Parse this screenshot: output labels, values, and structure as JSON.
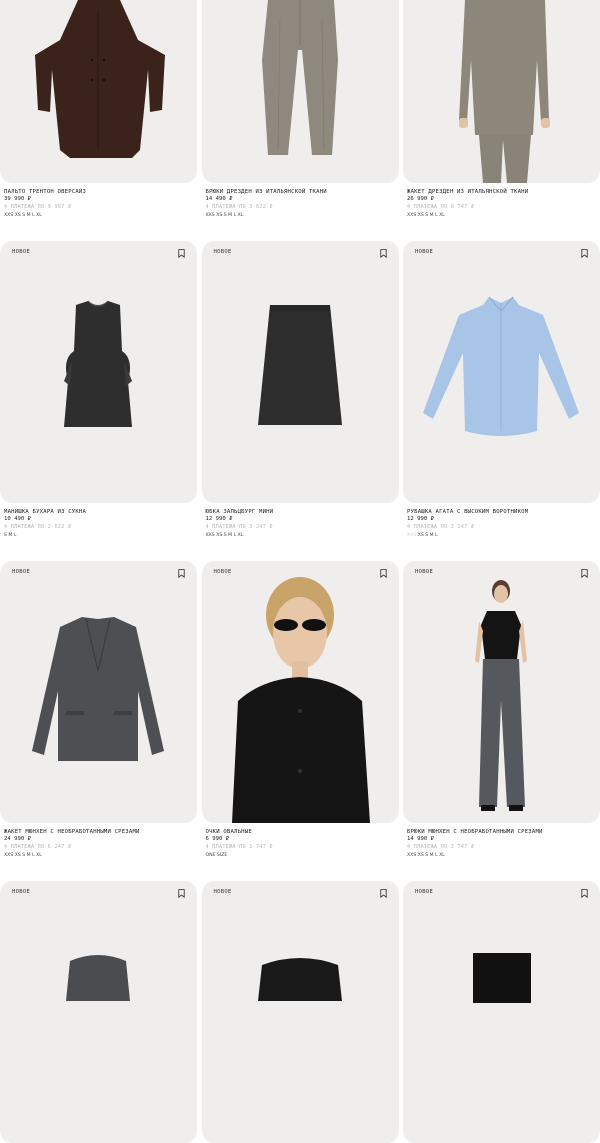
{
  "products": [
    {
      "title": "ПАЛЬТО ТРЕНТОН ОВЕРСАЙЗ",
      "price": "39 990 ₽",
      "installment": "4 ПЛАТЕЖА ПО 9 997 ₽",
      "sizes": [
        {
          "s": "XXS",
          "a": true
        },
        {
          "s": "XS",
          "a": true
        },
        {
          "s": "S",
          "a": true
        },
        {
          "s": "M",
          "a": true
        },
        {
          "s": "L",
          "a": true
        },
        {
          "s": "XL",
          "a": true
        }
      ],
      "badge": "",
      "illustration": "coat-brown"
    },
    {
      "title": "БРЮКИ ДРЕЗДЕН ИЗ ИТАЛЬЯНСКОЙ ТКАНИ",
      "price": "14 490 ₽",
      "installment": "4 ПЛАТЕЖА ПО 3 622 ₽",
      "sizes": [
        {
          "s": "XXS",
          "a": true
        },
        {
          "s": "XS",
          "a": true
        },
        {
          "s": "S",
          "a": true
        },
        {
          "s": "M",
          "a": true
        },
        {
          "s": "L",
          "a": true
        },
        {
          "s": "XL",
          "a": true
        }
      ],
      "badge": "",
      "illustration": "trousers-grey"
    },
    {
      "title": "ЖАКЕТ ДРЕЗДЕН ИЗ ИТАЛЬЯНСКОЙ ТКАНИ",
      "price": "26 990 ₽",
      "installment": "4 ПЛАТЕЖА ПО 6 747 ₽",
      "sizes": [
        {
          "s": "XXS",
          "a": true
        },
        {
          "s": "XS",
          "a": true
        },
        {
          "s": "S",
          "a": true
        },
        {
          "s": "M",
          "a": true
        },
        {
          "s": "L",
          "a": true
        },
        {
          "s": "XL",
          "a": true
        }
      ],
      "badge": "",
      "illustration": "jacket-model"
    },
    {
      "title": "МАНИШКА БУХАРА ИЗ СУКНА",
      "price": "10 490 ₽",
      "installment": "4 ПЛАТЕЖА ПО 2 622 ₽",
      "sizes": [
        {
          "s": "S",
          "a": true
        },
        {
          "s": "M",
          "a": true
        },
        {
          "s": "L",
          "a": true
        }
      ],
      "badge": "НОВОЕ",
      "illustration": "vest-black"
    },
    {
      "title": "ЮБКА ЗАЛЬЦБУРГ МИНИ",
      "price": "12 990 ₽",
      "installment": "4 ПЛАТЕЖА ПО 3 247 ₽",
      "sizes": [
        {
          "s": "XXS",
          "a": true
        },
        {
          "s": "XS",
          "a": true
        },
        {
          "s": "S",
          "a": true
        },
        {
          "s": "M",
          "a": true
        },
        {
          "s": "L",
          "a": true
        },
        {
          "s": "XL",
          "a": true
        }
      ],
      "badge": "НОВОЕ",
      "illustration": "skirt-black"
    },
    {
      "title": "РУБАШКА АГАТА С ВЫСОКИМ ВОРОТНИКОМ",
      "price": "12 990 ₽",
      "installment": "4 ПЛАТЕЖА ПО 3 247 ₽",
      "sizes": [
        {
          "s": "XXS",
          "a": false
        },
        {
          "s": "XS",
          "a": true
        },
        {
          "s": "S",
          "a": true
        },
        {
          "s": "M",
          "a": true
        },
        {
          "s": "L",
          "a": true
        }
      ],
      "badge": "НОВОЕ",
      "illustration": "shirt-blue"
    },
    {
      "title": "ЖАКЕТ МЮНХЕН С НЕОБРАБОТАННЫМИ СРЕЗАМИ",
      "price": "24 990 ₽",
      "installment": "4 ПЛАТЕЖА ПО 6 247 ₽",
      "sizes": [
        {
          "s": "XXS",
          "a": true
        },
        {
          "s": "XS",
          "a": true
        },
        {
          "s": "S",
          "a": true
        },
        {
          "s": "M",
          "a": true
        },
        {
          "s": "L",
          "a": true
        },
        {
          "s": "XL",
          "a": true
        }
      ],
      "badge": "НОВОЕ",
      "illustration": "blazer-grey"
    },
    {
      "title": "ОЧКИ ОВАЛЬНЫЕ",
      "price": "6 990 ₽",
      "installment": "4 ПЛАТЕЖА ПО 1 747 ₽",
      "sizes": [
        {
          "s": "ONE SIZE",
          "a": true
        }
      ],
      "badge": "НОВОЕ",
      "illustration": "model-sunglasses"
    },
    {
      "title": "БРЮКИ МЮНХЕН С НЕОБРАБОТАННЫМИ СРЕЗАМИ",
      "price": "14 990 ₽",
      "installment": "4 ПЛАТЕЖА ПО 3 747 ₽",
      "sizes": [
        {
          "s": "XXS",
          "a": true
        },
        {
          "s": "XS",
          "a": true
        },
        {
          "s": "S",
          "a": true
        },
        {
          "s": "M",
          "a": true
        },
        {
          "s": "L",
          "a": true
        },
        {
          "s": "XL",
          "a": true
        }
      ],
      "badge": "НОВОЕ",
      "illustration": "model-trousers"
    },
    {
      "title": "",
      "price": "",
      "installment": "",
      "sizes": [],
      "badge": "НОВОЕ",
      "illustration": "partial-top-dark"
    },
    {
      "title": "",
      "price": "",
      "installment": "",
      "sizes": [],
      "badge": "НОВОЕ",
      "illustration": "partial-shirt-black"
    },
    {
      "title": "",
      "price": "",
      "installment": "",
      "sizes": [],
      "badge": "НОВОЕ",
      "illustration": "partial-skirt-black"
    }
  ],
  "icons": {
    "bookmark": "bookmark-icon"
  },
  "colors": {
    "card_bg": "#efeeec",
    "installment": "#b4b4b4",
    "text": "#222222"
  }
}
